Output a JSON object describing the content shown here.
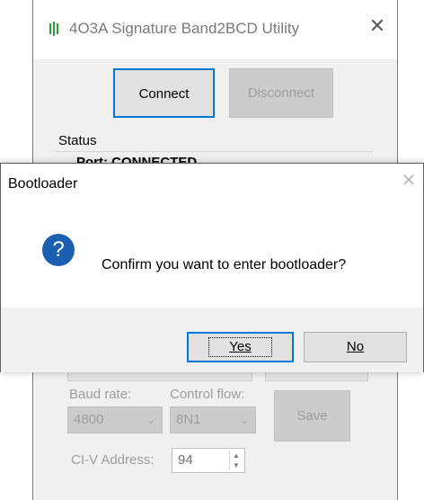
{
  "main_window": {
    "title": "4O3A Signature Band2BCD Utility",
    "connect_label": "Connect",
    "disconnect_label": "Disconnect",
    "status_group_label": "Status",
    "status_text": "Port: CONNECTED",
    "baud_rate_label": "Baud rate:",
    "baud_rate_value": "4800",
    "control_flow_label": "Control flow:",
    "control_flow_value": "8N1",
    "save_label": "Save",
    "civ_address_label": "CI-V Address:",
    "civ_address_value": "94"
  },
  "dialog": {
    "title": "Bootloader",
    "message": "Confirm you want to enter bootloader?",
    "yes_label": "Yes",
    "no_label": "No"
  },
  "icons": {
    "app": "app-icon",
    "close": "close-icon",
    "question": "question-icon"
  },
  "colors": {
    "accent": "#0078d7",
    "question_icon": "#1c5fb0",
    "app_icon": "#2a9d3b"
  }
}
